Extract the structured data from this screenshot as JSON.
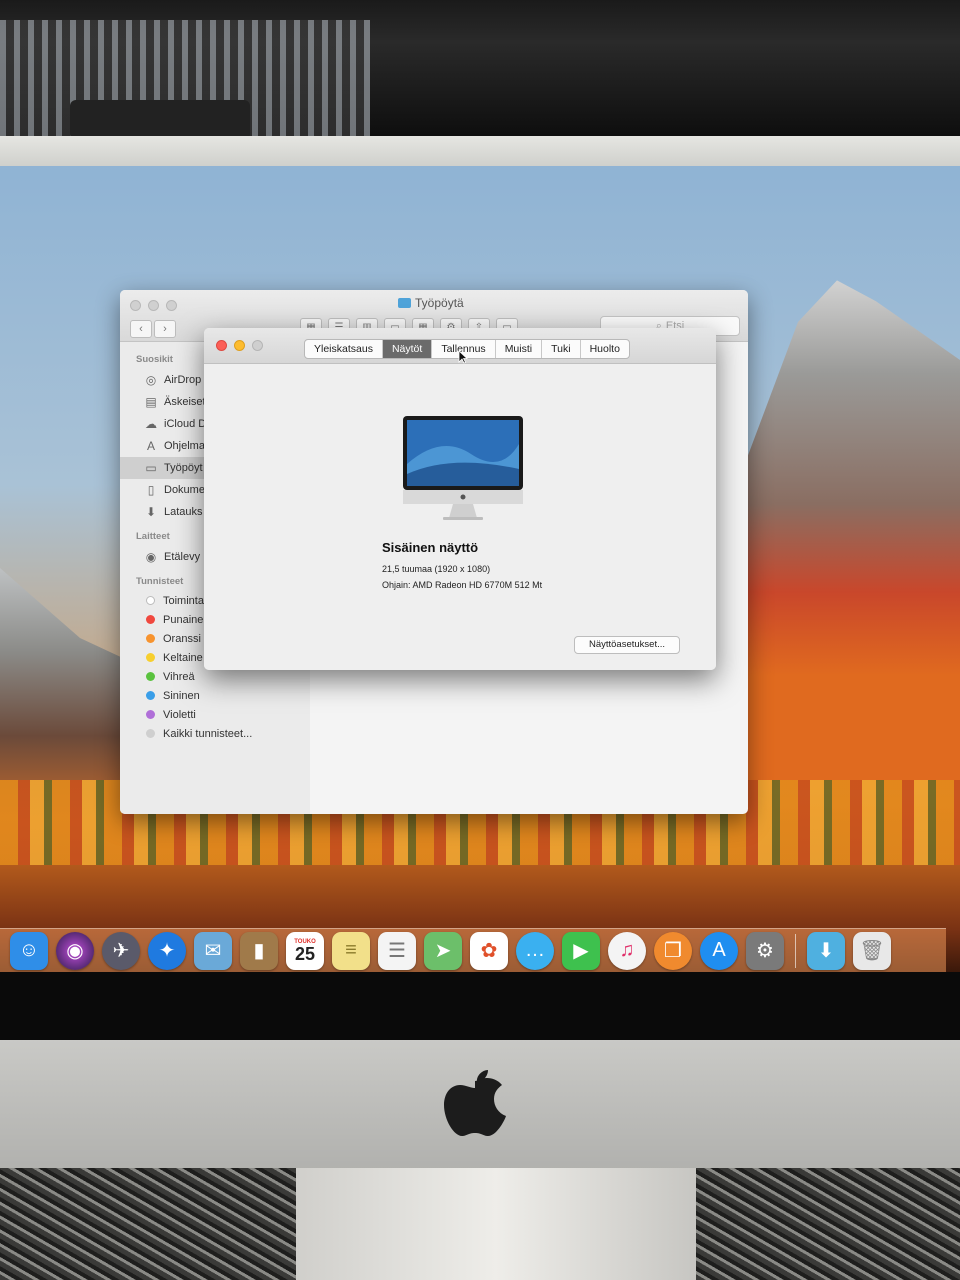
{
  "finder": {
    "title": "Työpöytä",
    "search_placeholder": "Etsi",
    "sidebar": {
      "favorites_header": "Suosikit",
      "favorites": [
        {
          "label": "AirDrop",
          "icon": "airdrop-icon"
        },
        {
          "label": "Äskeiset",
          "icon": "recents-icon"
        },
        {
          "label": "iCloud D",
          "icon": "cloud-icon"
        },
        {
          "label": "Ohjelma",
          "icon": "apps-icon"
        },
        {
          "label": "Työpöyt",
          "icon": "desktop-icon"
        },
        {
          "label": "Dokume",
          "icon": "document-icon"
        },
        {
          "label": "Latauks",
          "icon": "download-icon"
        }
      ],
      "devices_header": "Laitteet",
      "devices": [
        {
          "label": "Etälevy",
          "icon": "disc-icon"
        }
      ],
      "tags_header": "Tunnisteet",
      "tags": [
        {
          "label": "Toiminta",
          "color": "#ffffff"
        },
        {
          "label": "Punaine",
          "color": "#f0483e"
        },
        {
          "label": "Oranssi",
          "color": "#f7932e"
        },
        {
          "label": "Keltaine",
          "color": "#f7cf2e"
        },
        {
          "label": "Vihreä",
          "color": "#5ac23e"
        },
        {
          "label": "Sininen",
          "color": "#3a9ee8"
        },
        {
          "label": "Violetti",
          "color": "#b06fd8"
        },
        {
          "label": "Kaikki tunnisteet...",
          "color": "#cfcfcf"
        }
      ]
    }
  },
  "about": {
    "tabs": [
      "Yleiskatsaus",
      "Näytöt",
      "Tallennus",
      "Muisti",
      "Tuki",
      "Huolto"
    ],
    "active_tab": "Näytöt",
    "display_name": "Sisäinen näyttö",
    "size": "21,5 tuumaa (1920 x 1080)",
    "driver": "Ohjain: AMD Radeon HD 6770M 512 Mt",
    "settings_button": "Näyttöasetukset..."
  },
  "dock": {
    "calendar_month": "TOUKO",
    "calendar_day": "25",
    "apps": [
      {
        "name": "Finder",
        "icon": "finder-icon",
        "color": "#2f8ee8"
      },
      {
        "name": "Siri",
        "icon": "siri-icon",
        "color": "#2a1a4a"
      },
      {
        "name": "Launchpad",
        "icon": "launchpad-icon",
        "color": "#5a5a6a"
      },
      {
        "name": "Safari",
        "icon": "safari-icon",
        "color": "#1f7ae0"
      },
      {
        "name": "Mail",
        "icon": "mail-icon",
        "color": "#6aa9d8"
      },
      {
        "name": "Contacts",
        "icon": "contacts-icon",
        "color": "#a07a4a"
      },
      {
        "name": "Calendar",
        "icon": "calendar-icon",
        "color": "#ffffff"
      },
      {
        "name": "Notes",
        "icon": "notes-icon",
        "color": "#f2e08a"
      },
      {
        "name": "Reminders",
        "icon": "reminders-icon",
        "color": "#f4f4f4"
      },
      {
        "name": "Maps",
        "icon": "maps-icon",
        "color": "#6cbf6a"
      },
      {
        "name": "Photos",
        "icon": "photos-icon",
        "color": "#ffffff"
      },
      {
        "name": "Messages",
        "icon": "messages-icon",
        "color": "#3ab0f0"
      },
      {
        "name": "FaceTime",
        "icon": "facetime-icon",
        "color": "#3ec14e"
      },
      {
        "name": "iTunes",
        "icon": "itunes-icon",
        "color": "#f4f4f4"
      },
      {
        "name": "iBooks",
        "icon": "books-icon",
        "color": "#f08a2e"
      },
      {
        "name": "App Store",
        "icon": "appstore-icon",
        "color": "#1f8ef0"
      },
      {
        "name": "System Preferences",
        "icon": "gear-icon",
        "color": "#7a7a7a"
      },
      {
        "name": "Downloads",
        "icon": "folder-icon",
        "color": "#4fb0e0"
      },
      {
        "name": "Trash",
        "icon": "trash-icon",
        "color": "#e8e8e8"
      }
    ]
  }
}
